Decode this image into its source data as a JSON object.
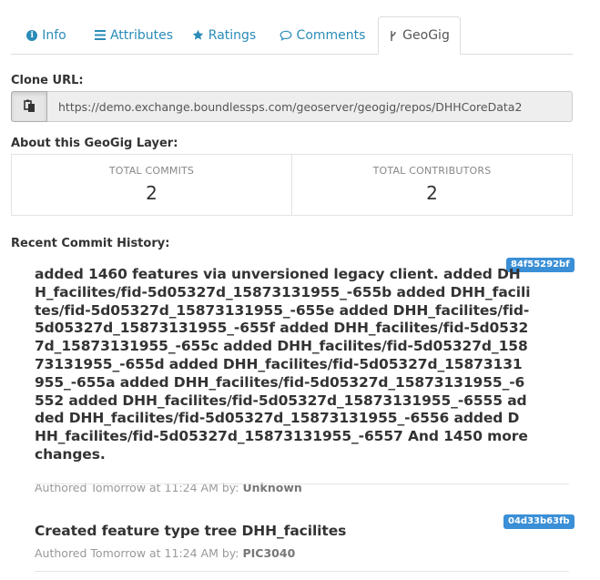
{
  "tabs": [
    {
      "label": "Info",
      "icon": "info-circle-icon"
    },
    {
      "label": "Attributes",
      "icon": "list-icon"
    },
    {
      "label": "Ratings",
      "icon": "star-icon"
    },
    {
      "label": "Comments",
      "icon": "comment-icon"
    },
    {
      "label": "GeoGig",
      "icon": "branch-icon"
    }
  ],
  "active_tab": "GeoGig",
  "clone": {
    "label": "Clone URL:",
    "url": "https://demo.exchange.boundlessps.com/geoserver/geogig/repos/DHHCoreData2",
    "copy_icon": "clipboard-icon"
  },
  "about": {
    "label": "About this GeoGig Layer:",
    "total_commits_label": "TOTAL COMMITS",
    "total_commits": "2",
    "total_contributors_label": "TOTAL CONTRIBUTORS",
    "total_contributors": "2"
  },
  "history": {
    "label": "Recent Commit History:",
    "commits": [
      {
        "id": "84f55292bf",
        "message": "added 1460 features via unversioned legacy client. added DHH_facilites/fid-5d05327d_15873131955_-655b added DHH_facilites/fid-5d05327d_15873131955_-655e added DHH_facilites/fid-5d05327d_15873131955_-655f added DHH_facilites/fid-5d05327d_15873131955_-655c added DHH_facilites/fid-5d05327d_15873131955_-655d added DHH_facilites/fid-5d05327d_15873131955_-655a added DHH_facilites/fid-5d05327d_15873131955_-6552 added DHH_facilites/fid-5d05327d_15873131955_-6555 added DHH_facilites/fid-5d05327d_15873131955_-6556 added DHH_facilites/fid-5d05327d_15873131955_-6557 And 1450 more changes.",
        "authored_prefix": "Authored Tomorrow at 11:24 AM by:",
        "author": "Unknown"
      },
      {
        "id": "04d33b63fb",
        "message": "Created feature type tree DHH_facilites",
        "authored_prefix": "Authored Tomorrow at 11:24 AM by:",
        "author": "PIC3040"
      }
    ]
  },
  "colors": {
    "link": "#2a8bb8",
    "badge": "#3a8fd6",
    "text": "#333333",
    "muted": "#999999"
  }
}
